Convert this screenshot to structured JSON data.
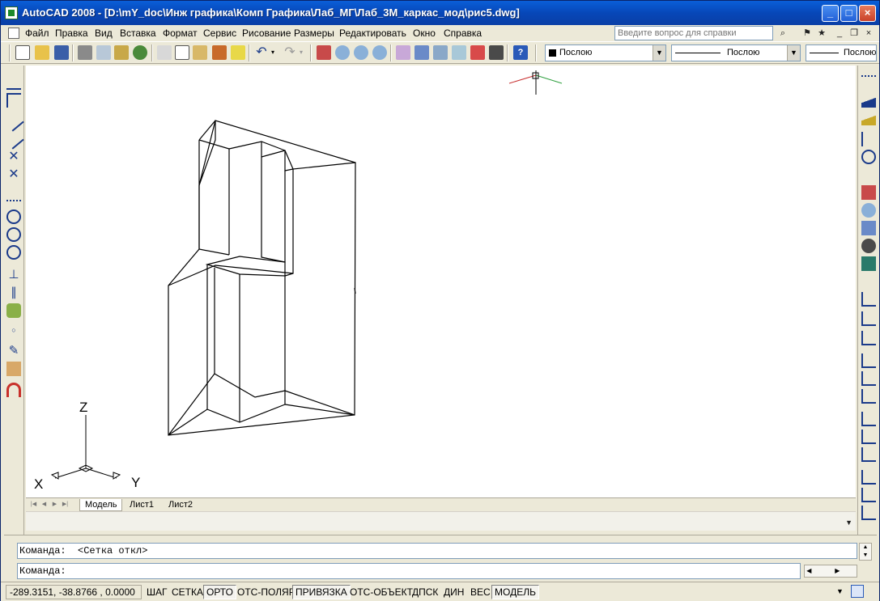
{
  "window": {
    "title": "AutoCAD 2008 - [D:\\mY_doc\\Инж графика\\Комп Графика\\Лаб_МГ\\Лаб_3М_каркас_мод\\рис5.dwg]"
  },
  "menu": {
    "items": [
      "Файл",
      "Правка",
      "Вид",
      "Вставка",
      "Формат",
      "Сервис",
      "Рисование",
      "Размеры",
      "Редактировать",
      "Окно",
      "Справка"
    ],
    "help_placeholder": "Введите вопрос для справки"
  },
  "toolbar": {
    "layer_value": "Послою",
    "linetype_value": "Послою",
    "lineweight_value": "Послою"
  },
  "canvas": {
    "ucs_x": "X",
    "ucs_y": "Y",
    "ucs_z": "Z"
  },
  "tabs": [
    "Модель",
    "Лист1",
    "Лист2"
  ],
  "command": {
    "history": "Команда:  <Сетка откл>",
    "prompt": "Команда:"
  },
  "status": {
    "coords": "-289.3151, -38.8766 , 0.0000",
    "buttons": [
      {
        "label": "ШАГ",
        "on": false
      },
      {
        "label": "СЕТКА",
        "on": false
      },
      {
        "label": "ОРТО",
        "on": true
      },
      {
        "label": "ОТС-ПОЛЯР",
        "on": false
      },
      {
        "label": "ПРИВЯЗКА",
        "on": true
      },
      {
        "label": "ОТС-ОБЪЕКТ",
        "on": false
      },
      {
        "label": "ДПСК",
        "on": false
      },
      {
        "label": "ДИН",
        "on": false
      },
      {
        "label": "ВЕС",
        "on": false
      },
      {
        "label": "МОДЕЛЬ",
        "on": true
      }
    ]
  }
}
